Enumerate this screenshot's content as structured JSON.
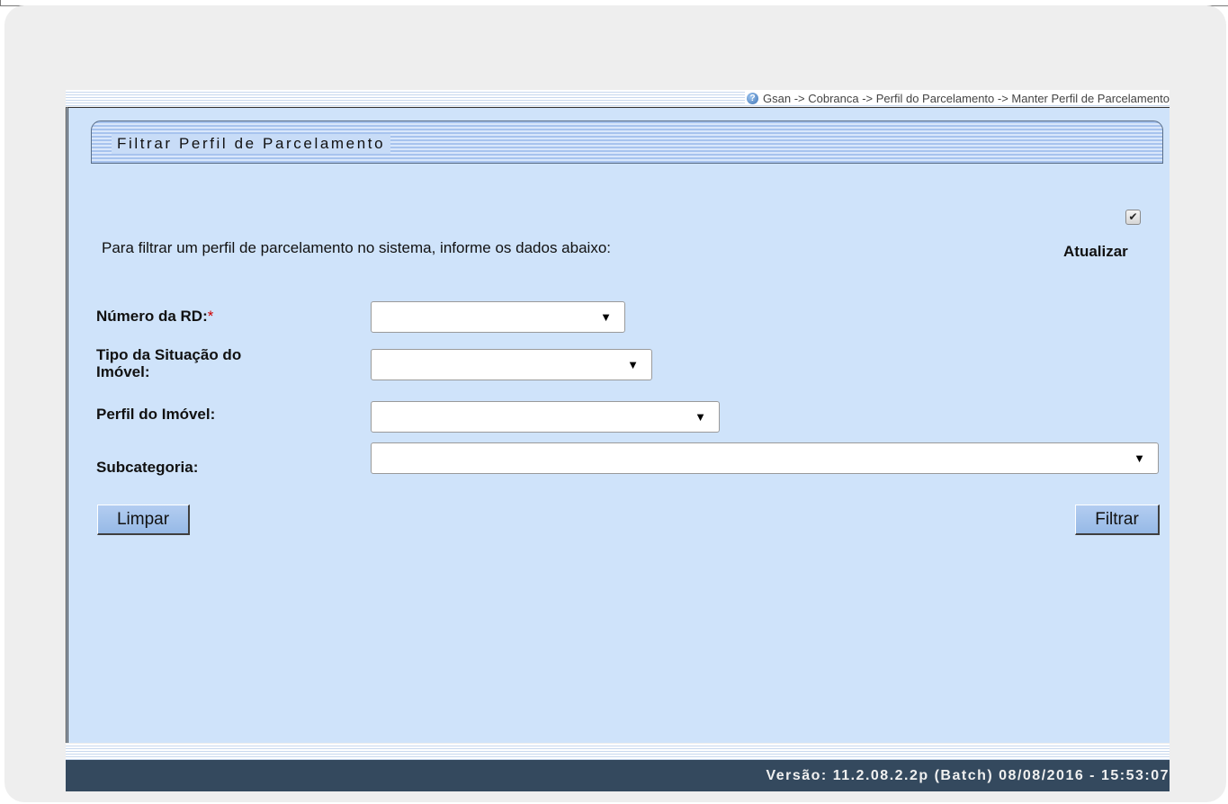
{
  "breadcrumb": "Gsan -> Cobranca -> Perfil do Parcelamento -> Manter Perfil de Parcelamento",
  "panel": {
    "title": "Filtrar Perfil de Parcelamento",
    "intro": "Para filtrar um perfil de parcelamento no sistema, informe os dados abaixo:",
    "refresh_label": "Atualizar",
    "refresh_checked": true
  },
  "fields": {
    "numero_rd": {
      "label": "Número da RD:",
      "required_mark": "*",
      "value": ""
    },
    "tipo_situacao": {
      "label_line1": "Tipo da Situação do",
      "label_line2": "Imóvel:",
      "value": ""
    },
    "perfil_imovel": {
      "label": "Perfil do Imóvel:",
      "value": ""
    },
    "subcategoria": {
      "label": "Subcategoria:",
      "value": ""
    }
  },
  "buttons": {
    "limpar": "Limpar",
    "filtrar": "Filtrar"
  },
  "footer": {
    "version": "Versão: 11.2.08.2.2p (Batch) 08/08/2016 - 15:53:07"
  },
  "icons": {
    "help": "help-icon",
    "caret": "caret-down-icon",
    "check": "checkbox-checked-icon"
  }
}
